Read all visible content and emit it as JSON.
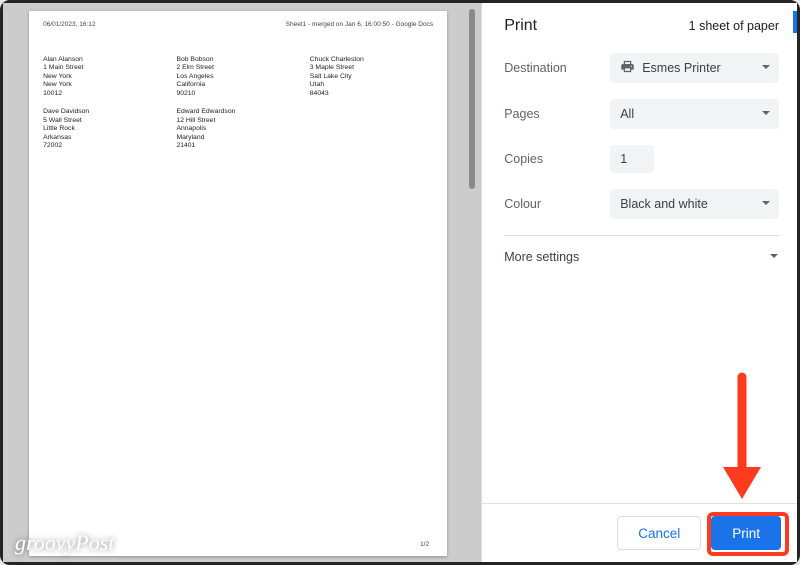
{
  "preview": {
    "header_left": "06/01/2023, 16:12",
    "header_right": "Sheet1 - merged on Jan 6, 16:00:50 - Google Docs",
    "footer": "1/2",
    "labels": [
      [
        "Alan Alanson",
        "1 Main Street",
        "New York",
        "New York",
        "10012"
      ],
      [
        "Bob Bobson",
        "2 Elm Street",
        "Los Angeles",
        "California",
        "90210"
      ],
      [
        "Chuck Charleston",
        "3 Maple Street",
        "Salt Lake City",
        "Utah",
        "84043"
      ],
      [
        "Dave Davidson",
        "5 Wall Street",
        "Little Rock",
        "Arkansas",
        "72002"
      ],
      [
        "Edward Edwardson",
        "12 Hill Street",
        "Annapolis",
        "Maryland",
        "21401"
      ]
    ]
  },
  "panel": {
    "title": "Print",
    "sheet_count": "1 sheet of paper",
    "destination_label": "Destination",
    "destination_value": "Esmes Printer",
    "pages_label": "Pages",
    "pages_value": "All",
    "copies_label": "Copies",
    "copies_value": "1",
    "colour_label": "Colour",
    "colour_value": "Black and white",
    "more_label": "More settings"
  },
  "actions": {
    "cancel": "Cancel",
    "print": "Print"
  },
  "watermark": "groovyPost"
}
